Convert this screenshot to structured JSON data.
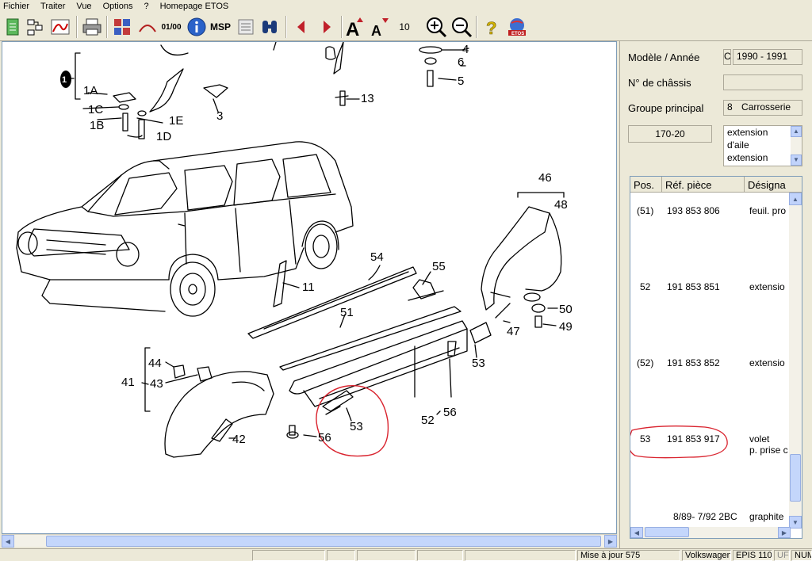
{
  "menu": [
    "Fichier",
    "Traiter",
    "Vue",
    "Options",
    "?",
    "Homepage ETOS"
  ],
  "toolbar": {
    "font_size_value": "10",
    "msp_label": "MSP",
    "scale_label": "01/00",
    "etos_label": "ETOS"
  },
  "drawing": {
    "callouts": {
      "c1": "1",
      "c1A": "1A",
      "c1C": "1C",
      "c1B": "1B",
      "c1E": "1E",
      "c1D": "1D",
      "c3": "3",
      "c4": "4",
      "c6": "6",
      "c5": "5",
      "c13": "13",
      "c46": "46",
      "c48": "48",
      "c54": "54",
      "c55": "55",
      "c11": "11",
      "c51": "51",
      "c50": "50",
      "c49": "49",
      "c47": "47",
      "c53a": "53",
      "c44": "44",
      "c41": "41",
      "c43": "43",
      "c42": "42",
      "c53b": "53",
      "c56a": "56",
      "c52": "52",
      "c56b": "56"
    },
    "highlight_color": "#d9232e"
  },
  "panel": {
    "model_label": "Modèle / Année",
    "model_value": "C",
    "year_value": "1990 - 1991",
    "chassis_label": "N° de châssis",
    "chassis_value": "",
    "group_label": "Groupe principal",
    "group_number": "8",
    "group_name": "Carrosserie",
    "subgroup_code": "170-20",
    "subgroup_desc": [
      "extension",
      "d'aile",
      "extension"
    ]
  },
  "parts": {
    "headers": [
      "Pos.",
      "Réf. pièce",
      "Désigna"
    ],
    "rows": [
      {
        "pos": "(51)",
        "ref": "193 853 806",
        "desc": [
          "feuil. pro"
        ]
      },
      {
        "pos": "52",
        "ref": "191 853 851",
        "desc": [
          "extensio"
        ]
      },
      {
        "pos": "(52)",
        "ref": "191 853 852",
        "desc": [
          "extensio"
        ]
      },
      {
        "pos": "53",
        "ref": "191 853 917",
        "desc": [
          "volet",
          "p. prise c"
        ]
      }
    ],
    "footer_text": "8/89- 7/92 2BC",
    "footer_desc": "graphite"
  },
  "status": {
    "update": "Mise à jour 575",
    "brand": "Volkswagen",
    "epis": "EPIS 110",
    "uf": "UF",
    "num": "NUM"
  }
}
